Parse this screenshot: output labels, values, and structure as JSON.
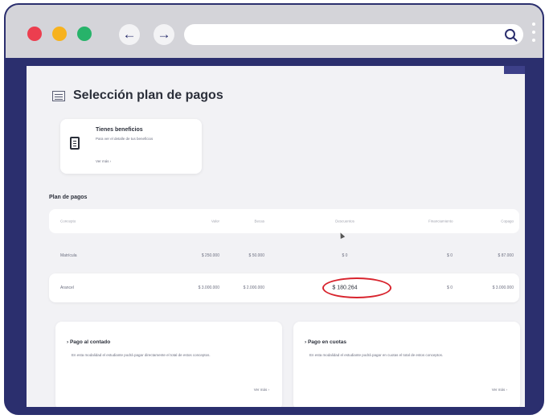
{
  "browser": {
    "nav_back_glyph": "←",
    "nav_forward_glyph": "→",
    "url": "",
    "icons": [
      "search-icon",
      "kebab-menu-icon"
    ],
    "dot_colors": [
      "#ec3e4f",
      "#f7b21e",
      "#27b36a"
    ],
    "frame_color": "#2b2f6e"
  },
  "page": {
    "title": "Selección plan de pagos",
    "benefits_card": {
      "title": "Tienes beneficios",
      "description": "Para ver el detalle de tus beneficios",
      "link": "Ver más ›"
    },
    "plan_section_title": "Plan de pagos",
    "table": {
      "headers": [
        "Concepto",
        "Valor",
        "Becas",
        "Descuentos",
        "Financiamiento",
        "Copago"
      ],
      "rows": [
        [
          "Matrícula",
          "$ 250.000",
          "$ 50.000",
          "$ 0",
          "$ 0",
          "$ 87.000"
        ],
        [
          "Arancel",
          "$ 3.000.000",
          "$ 2.000.000",
          "$ 180.264",
          "$ 0",
          "$ 3.000.000"
        ]
      ],
      "highlighted_value": "$ 180.264",
      "highlight_color": "#d8242e"
    },
    "payment_options": [
      {
        "title": "› Pago al contado",
        "description": "En esta modalidad el estudiante podrá pagar directamente el total de estos conceptos.",
        "link": "Ver más ›"
      },
      {
        "title": "› Pago en cuotas",
        "description": "En esta modalidad el estudiante podrá pagar en cuotas el total de estos conceptos.",
        "link": "Ver más ›"
      }
    ]
  }
}
